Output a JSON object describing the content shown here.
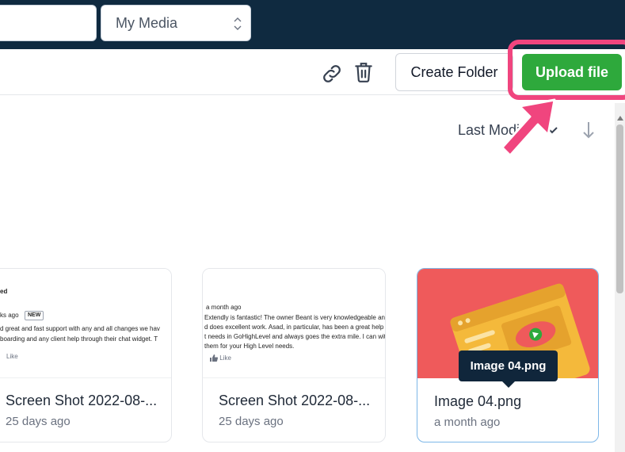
{
  "header": {
    "media_select": {
      "value": "My Media"
    }
  },
  "toolbar": {
    "create_folder_label": "Create Folder",
    "upload_label": "Upload file"
  },
  "sort": {
    "label": "Last Modi"
  },
  "highlight_color": "#f0457e",
  "accent_color": "#2ea93c",
  "cards": [
    {
      "title": "Screen Shot 2022-08-...",
      "subtitle": "25 days ago",
      "preview": {
        "author": "ed",
        "time": "ks ago",
        "badge": "NEW",
        "line1": "d great and fast support with any and all changes we hav",
        "line2": "boarding and any client help through their chat widget. T",
        "like": "Like"
      }
    },
    {
      "title": "Screen Shot 2022-08-...",
      "subtitle": "25 days ago",
      "preview": {
        "time": "a month ago",
        "line1": "Extendly is fantastic! The owner Beant is very knowledgeable and he",
        "line2": "d does excellent work. Asad, in particular, has been a great help to o",
        "line3": "t needs in GoHighLevel and always goes the extra mile. I can with gre",
        "line4": "them for your High Level needs.",
        "like": "Like"
      }
    },
    {
      "title": "Image 04.png",
      "subtitle": "a month ago",
      "tooltip": "Image 04.png"
    }
  ]
}
